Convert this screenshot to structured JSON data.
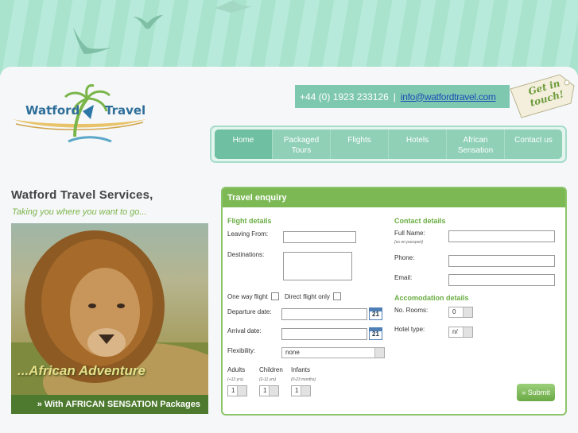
{
  "brand": {
    "word1": "Watford",
    "word2": "Travel"
  },
  "contact": {
    "phone": "+44 (0) 1923 233126",
    "separator": "|",
    "email": "info@watfordtravel.com",
    "tag_text_1": "Get in",
    "tag_text_2": "touch!"
  },
  "nav": {
    "items": [
      {
        "line1": "Home",
        "line2": ""
      },
      {
        "line1": "Packaged",
        "line2": "Tours"
      },
      {
        "line1": "Flights",
        "line2": ""
      },
      {
        "line1": "Hotels",
        "line2": ""
      },
      {
        "line1": "African",
        "line2": "Sensation"
      },
      {
        "line1": "Contact us",
        "line2": ""
      }
    ]
  },
  "intro": {
    "title": "Watford Travel Services,",
    "tagline": "Taking you where you want to go..."
  },
  "hero": {
    "caption": "...African Adventure",
    "banner": "» With AFRICAN SENSATION Packages"
  },
  "form": {
    "title": "Travel enquiry",
    "flight": {
      "section": "Flight details",
      "leaving_from": "Leaving From:",
      "destinations": "Destinations:",
      "one_way": "One way flight",
      "direct": "Direct flight only",
      "departure": "Departure date:",
      "arrival": "Arrival date:",
      "flexibility": "Flexibility:",
      "flexibility_value": "none",
      "adults": "Adults",
      "adults_hint": "(+12 yrs)",
      "children": "Children",
      "children_hint": "(2-11 yrs)",
      "infants": "Infants",
      "infants_hint": "(0-23 months)",
      "adults_value": "1",
      "children_value": "1",
      "infants_value": "1",
      "calendar_day": "21"
    },
    "contact": {
      "section": "Contact details",
      "full_name": "Full Name:",
      "full_name_hint": "(as on passport)",
      "phone": "Phone:",
      "email": "Email:"
    },
    "accom": {
      "section": "Accomodation details",
      "rooms": "No. Rooms:",
      "rooms_value": "0",
      "hotel_type": "Hotel type:",
      "hotel_type_value": "n/"
    },
    "submit": "» Submit"
  },
  "colors": {
    "accent_green": "#7cb955",
    "mint": "#8fd0b7",
    "email_blue": "#1c4db7"
  }
}
